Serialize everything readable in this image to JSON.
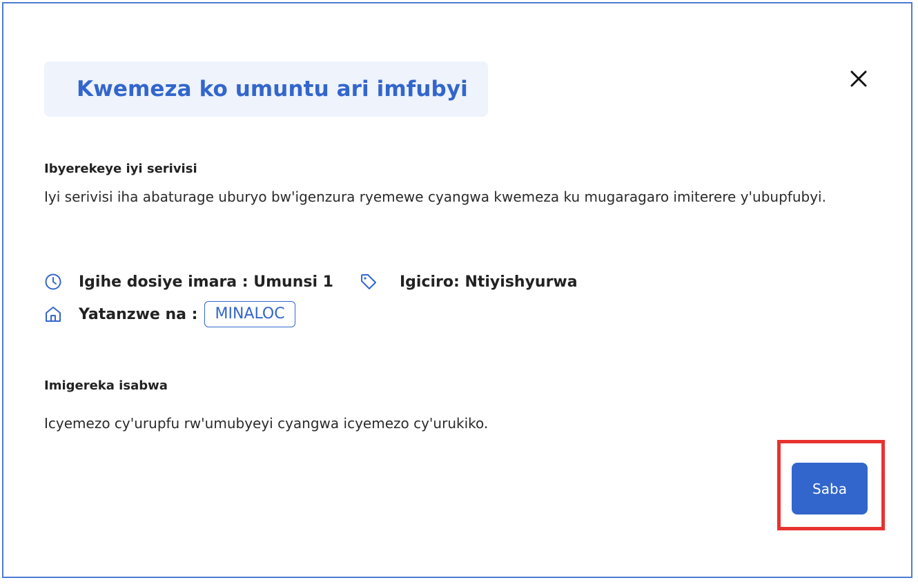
{
  "dialog": {
    "title": "Kwemeza ko umuntu ari imfubyi",
    "close_icon": "close-icon"
  },
  "about": {
    "heading": "Ibyerekeye iyi serivisi",
    "text": "Iyi serivisi iha abaturage uburyo bw'igenzura ryemewe cyangwa kwemeza ku mugaragaro imiterere y'ubupfubyi."
  },
  "meta": {
    "duration_label": "Igihe dosiye imara : Umunsi 1",
    "price_label": "Igiciro: Ntiyishyurwa",
    "provider_label": "Yatanzwe na :",
    "provider_value": "MINALOC",
    "icons": {
      "duration": "clock-icon",
      "price": "tag-icon",
      "provider": "building-icon"
    }
  },
  "requirements": {
    "heading": "Imigereka isabwa",
    "text": "Icyemezo cy'urupfu rw'umubyeyi cyangwa icyemezo cy'urukiko."
  },
  "actions": {
    "submit_label": "Saba"
  },
  "colors": {
    "accent": "#3366cc",
    "title_bg": "#eef3fc",
    "highlight": "#e8322f",
    "frame_border": "#4a7bd4"
  }
}
